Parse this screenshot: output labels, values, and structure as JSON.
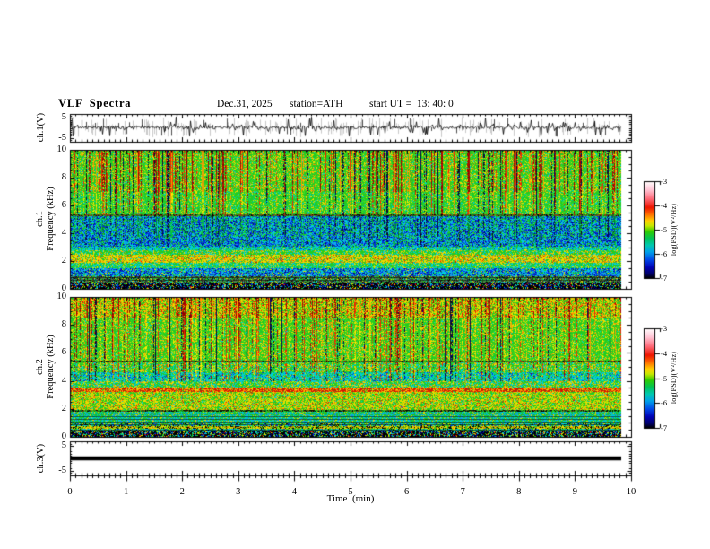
{
  "header": {
    "title": "VLF  Spectra",
    "date": "Dec.31, 2025",
    "station": "station=ATH",
    "start_ut": "start UT =  13: 40: 0"
  },
  "axes": {
    "time": {
      "label": "Time  (min)",
      "ticks": [
        "0",
        "1",
        "2",
        "3",
        "4",
        "5",
        "6",
        "7",
        "8",
        "9",
        "10"
      ],
      "range_min": [
        0,
        10
      ]
    },
    "wave_ticks": [
      "5",
      "-5"
    ],
    "freq_ticks": [
      "0",
      "2",
      "4",
      "6",
      "8",
      "10"
    ]
  },
  "colorbar": {
    "label": "log(PSD)(V²/Hz)",
    "ticks": [
      "-3",
      "-4",
      "-5",
      "-6",
      "-7"
    ],
    "range": [
      -3,
      -7
    ],
    "gradient": [
      [
        0,
        "#ffffff"
      ],
      [
        0.09,
        "#ffc4d4"
      ],
      [
        0.18,
        "#ff6b7a"
      ],
      [
        0.27,
        "#ee1500"
      ],
      [
        0.34,
        "#ff6a00"
      ],
      [
        0.41,
        "#ffd000"
      ],
      [
        0.46,
        "#c8e800"
      ],
      [
        0.52,
        "#2fcc00"
      ],
      [
        0.59,
        "#00c455"
      ],
      [
        0.66,
        "#00c8b0"
      ],
      [
        0.73,
        "#00a2e8"
      ],
      [
        0.81,
        "#0048e8"
      ],
      [
        0.89,
        "#0000b4"
      ],
      [
        0.96,
        "#000060"
      ],
      [
        1,
        "#000000"
      ]
    ]
  },
  "chart_data": [
    {
      "type": "line",
      "title": "ch.1(V)",
      "ylim": [
        -7,
        7
      ],
      "ytick_values": [
        5,
        -5
      ],
      "x_range_min": [
        0,
        10
      ],
      "data_end_min": 9.82,
      "signal": {
        "baseline_v": 0,
        "noise_sigma_v": 0.85,
        "spike_prob": 0.11,
        "gray_spike_prob": 0.3,
        "spike_max_v": 5
      }
    },
    {
      "type": "heatmap",
      "channel": "ch.1",
      "ylabel": "Frequency (kHz)",
      "ylim_khz": [
        0,
        10
      ],
      "x_range_min": [
        0,
        10
      ],
      "data_end_min": 9.82,
      "z_label": "log(PSD)(V²/Hz)",
      "z_range": [
        -7,
        -3
      ],
      "stripes": {
        "strong_dark_prob": 0.012,
        "dark_prob": 0.078,
        "hot_prob": 0.31
      },
      "bands": [
        {
          "f": [
            0,
            0.4
          ],
          "colors": [
            "#000000",
            "#000088",
            "#0033dd",
            "#00ccdd",
            "#22cc22",
            "#eedd00",
            "#dd1100"
          ],
          "w": [
            0.5,
            0.12,
            0.08,
            0.09,
            0.08,
            0.08,
            0.05
          ]
        },
        {
          "f": [
            0.4,
            0.9
          ],
          "colors": [
            "#333333",
            "#557755",
            "#22cc22",
            "#00ccdd",
            "#000000",
            "#eedd00"
          ],
          "w": [
            0.28,
            0.25,
            0.2,
            0.1,
            0.1,
            0.07
          ],
          "rows": true
        },
        {
          "f": [
            0.9,
            1.5
          ],
          "colors": [
            "#0033dd",
            "#00ccdd",
            "#2288ff",
            "#22cc22",
            "#000088",
            "#eedd00"
          ],
          "w": [
            0.28,
            0.27,
            0.15,
            0.15,
            0.1,
            0.05
          ]
        },
        {
          "f": [
            1.5,
            1.9
          ],
          "colors": [
            "#22cc22",
            "#00ccdd",
            "#00cc88",
            "#eedd00"
          ],
          "w": [
            0.4,
            0.3,
            0.15,
            0.15
          ]
        },
        {
          "f": [
            1.9,
            2.45
          ],
          "colors": [
            "#eedd00",
            "#22cc22",
            "#ff8800",
            "#999900",
            "#00ccdd",
            "#dd1100"
          ],
          "w": [
            0.45,
            0.2,
            0.15,
            0.1,
            0.06,
            0.04
          ]
        },
        {
          "f": [
            2.45,
            2.75
          ],
          "colors": [
            "#22cc22",
            "#eedd00",
            "#00ccdd",
            "#ff8800"
          ],
          "w": [
            0.55,
            0.2,
            0.2,
            0.05
          ]
        },
        {
          "f": [
            2.75,
            3.05
          ],
          "colors": [
            "#00ccdd",
            "#22cc22",
            "#00cc88",
            "#0033dd",
            "#eedd00"
          ],
          "w": [
            0.45,
            0.25,
            0.15,
            0.1,
            0.05
          ]
        },
        {
          "f": [
            3.05,
            3.75
          ],
          "colors": [
            "#0033dd",
            "#00ccdd",
            "#2288ff",
            "#22cc22",
            "#000088"
          ],
          "w": [
            0.3,
            0.3,
            0.12,
            0.18,
            0.1
          ],
          "stripe": 0.5,
          "style": "green"
        },
        {
          "f": [
            3.75,
            5.2
          ],
          "colors": [
            "#00ccdd",
            "#0033dd",
            "#22cc22",
            "#2288ff",
            "#000088"
          ],
          "w": [
            0.3,
            0.25,
            0.25,
            0.1,
            0.1
          ],
          "stripe": 0.85,
          "style": "green"
        },
        {
          "f": [
            5.2,
            5.35
          ],
          "colors": [
            "#884411",
            "#116622",
            "#22cc22",
            "#000000"
          ],
          "w": [
            0.35,
            0.25,
            0.2,
            0.2
          ]
        },
        {
          "f": [
            5.35,
            7.0
          ],
          "colors": [
            "#22cc22",
            "#44dd22",
            "#eedd00",
            "#00ccdd",
            "#00cc88"
          ],
          "w": [
            0.55,
            0.16,
            0.14,
            0.08,
            0.07
          ],
          "stripe": 1.0
        },
        {
          "f": [
            7.0,
            10.01
          ],
          "colors": [
            "#22cc22",
            "#44dd22",
            "#eedd00",
            "#ff8800",
            "#00ccdd"
          ],
          "w": [
            0.5,
            0.18,
            0.2,
            0.07,
            0.05
          ],
          "stripe": 1.25,
          "heatAdd": 0.35
        }
      ]
    },
    {
      "type": "heatmap",
      "channel": "ch.2",
      "ylabel": "Frequency (kHz)",
      "ylim_khz": [
        0,
        10
      ],
      "x_range_min": [
        0,
        10
      ],
      "data_end_min": 9.82,
      "z_label": "log(PSD)(V²/Hz)",
      "z_range": [
        -7,
        -3
      ],
      "stripes": {
        "strong_dark_prob": 0.012,
        "dark_prob": 0.07,
        "hot_prob": 0.3
      },
      "bands": [
        {
          "f": [
            0,
            0.45
          ],
          "colors": [
            "#000000",
            "#000088",
            "#00ccdd",
            "#22cc22",
            "#eedd00",
            "#0033dd",
            "#dd1100"
          ],
          "w": [
            0.45,
            0.1,
            0.12,
            0.12,
            0.1,
            0.06,
            0.05
          ]
        },
        {
          "f": [
            0.45,
            0.6
          ],
          "colors": [
            "#00ccdd",
            "#22cc22",
            "#000000",
            "#eedd00",
            "#0033dd"
          ],
          "w": [
            0.35,
            0.35,
            0.1,
            0.1,
            0.1
          ],
          "rows": true
        },
        {
          "f": [
            0.6,
            0.78
          ],
          "colors": [
            "#eedd00",
            "#999900",
            "#000000",
            "#22cc22",
            "#ff8800"
          ],
          "w": [
            0.35,
            0.2,
            0.2,
            0.15,
            0.1
          ]
        },
        {
          "f": [
            0.78,
            1.05
          ],
          "colors": [
            "#00ccdd",
            "#22cc22",
            "#000000",
            "#0033dd",
            "#eedd00"
          ],
          "w": [
            0.3,
            0.3,
            0.12,
            0.13,
            0.15
          ],
          "rows": true
        },
        {
          "f": [
            1.05,
            1.8
          ],
          "colors": [
            "#00ccdd",
            "#22cc22",
            "#00cc88",
            "#2288ff",
            "#eedd00"
          ],
          "w": [
            0.35,
            0.35,
            0.12,
            0.08,
            0.1
          ],
          "rows": true
        },
        {
          "f": [
            1.8,
            1.95
          ],
          "colors": [
            "#000000",
            "#116622",
            "#22cc22",
            "#884411"
          ],
          "w": [
            0.3,
            0.3,
            0.25,
            0.15
          ]
        },
        {
          "f": [
            1.95,
            3.2
          ],
          "colors": [
            "#22cc22",
            "#eedd00",
            "#aadd00",
            "#ff8800",
            "#dd1100",
            "#00ccdd"
          ],
          "w": [
            0.35,
            0.3,
            0.15,
            0.12,
            0.04,
            0.04
          ]
        },
        {
          "f": [
            3.2,
            3.5
          ],
          "colors": [
            "#dd1100",
            "#ff8800",
            "#eedd00",
            "#884411",
            "#22cc22"
          ],
          "w": [
            0.4,
            0.3,
            0.15,
            0.1,
            0.05
          ]
        },
        {
          "f": [
            3.5,
            4.0
          ],
          "colors": [
            "#22cc22",
            "#00ccdd",
            "#eedd00",
            "#ff8800"
          ],
          "w": [
            0.45,
            0.25,
            0.2,
            0.1
          ]
        },
        {
          "f": [
            4.0,
            4.6
          ],
          "colors": [
            "#00ccdd",
            "#22cc22",
            "#00cc88",
            "#0033dd",
            "#eedd00"
          ],
          "w": [
            0.45,
            0.25,
            0.15,
            0.1,
            0.05
          ],
          "stripe": 0.6
        },
        {
          "f": [
            4.6,
            5.3
          ],
          "colors": [
            "#22cc22",
            "#00ccdd",
            "#eedd00",
            "#ff8800"
          ],
          "w": [
            0.55,
            0.2,
            0.18,
            0.07
          ],
          "stripe": 0.8
        },
        {
          "f": [
            5.3,
            5.45
          ],
          "colors": [
            "#884411",
            "#116622",
            "#22cc22",
            "#000000"
          ],
          "w": [
            0.3,
            0.3,
            0.25,
            0.15
          ]
        },
        {
          "f": [
            5.45,
            8.5
          ],
          "colors": [
            "#22cc22",
            "#44dd22",
            "#eedd00",
            "#00ccdd",
            "#ff8800"
          ],
          "w": [
            0.55,
            0.17,
            0.2,
            0.04,
            0.04
          ],
          "stripe": 1.0
        },
        {
          "f": [
            8.5,
            10.01
          ],
          "colors": [
            "#eedd00",
            "#22cc22",
            "#aadd00",
            "#ff8800",
            "#dd1100"
          ],
          "w": [
            0.33,
            0.35,
            0.12,
            0.12,
            0.08
          ],
          "stripe": 1.15,
          "heatAdd": 0.3
        }
      ]
    },
    {
      "type": "line",
      "title": "ch.3(V)",
      "ylim": [
        -7,
        7
      ],
      "ytick_values": [
        5,
        -5
      ],
      "x_range_min": [
        0,
        10
      ],
      "data_end_min": 9.82,
      "signal": {
        "constant_v": 0,
        "line_thickness_px": 4.5
      }
    }
  ]
}
